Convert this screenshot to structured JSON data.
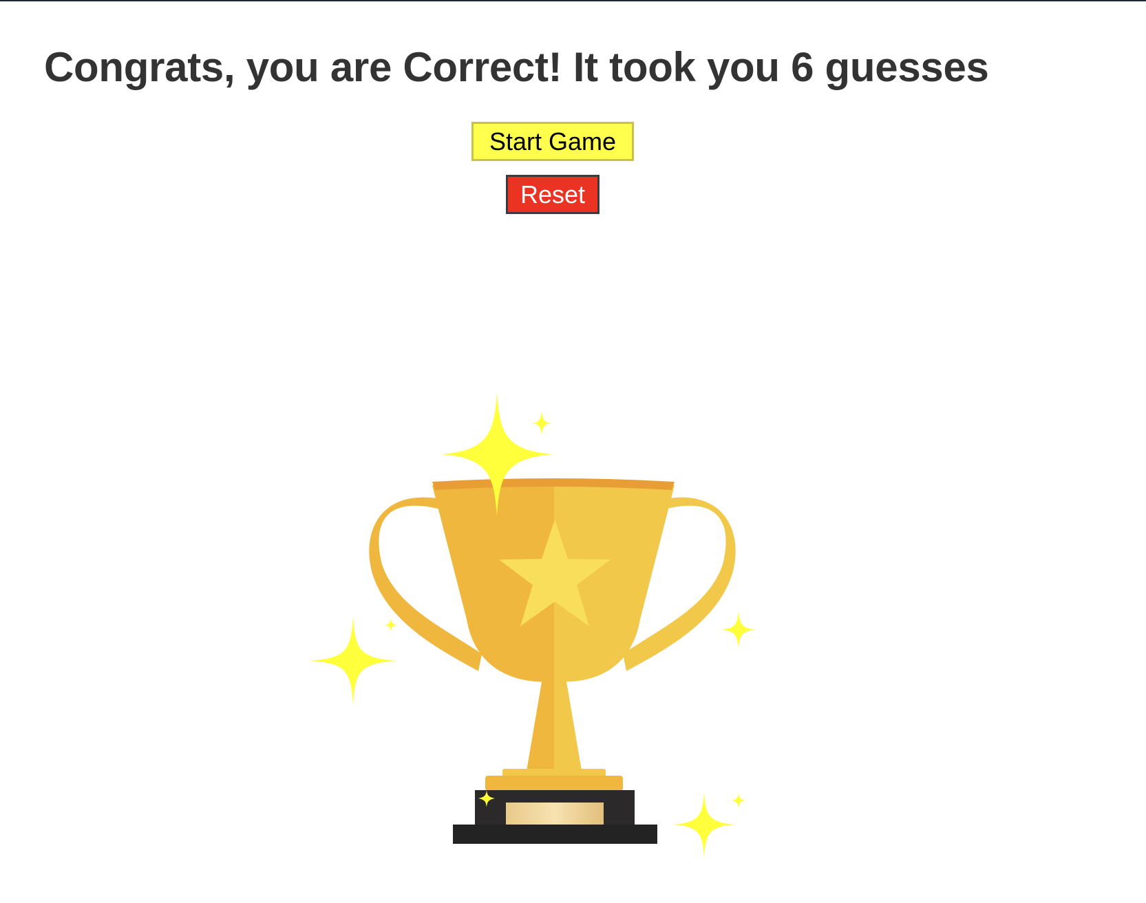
{
  "result": {
    "message": "Congrats, you are Correct! It took you 6 guesses",
    "guess_count": 6
  },
  "controls": {
    "start_label": "Start Game",
    "reset_label": "Reset"
  },
  "colors": {
    "start_button": "#ffff4d",
    "reset_button": "#ea3323",
    "trophy_gold": "#f0b73e",
    "sparkle": "#ffff3c"
  },
  "image": {
    "icon": "trophy-icon"
  }
}
